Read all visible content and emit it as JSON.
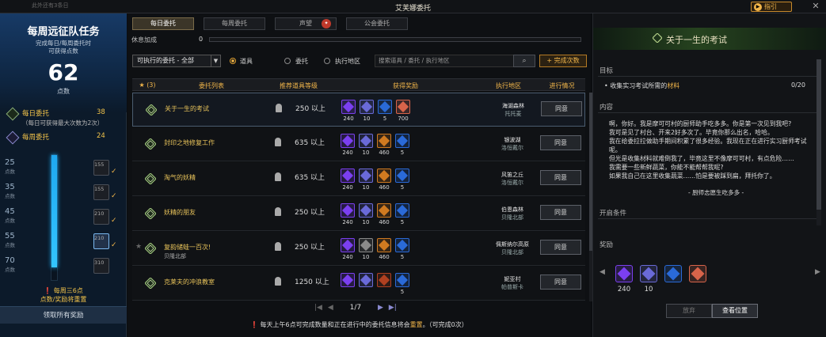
{
  "topbar": {
    "title": "艾芙娜委托",
    "tiny": "此外还有3条日",
    "guide": "指引",
    "close": "✕"
  },
  "left": {
    "title": "每周远征队任务",
    "subtitle_1": "完成每日/每周委托时",
    "subtitle_2": "可获得点数",
    "points": "62",
    "points_unit": "点数",
    "daily_label": "每日委托",
    "daily_value": "38",
    "daily_note": "（每日可获得最大次数为2次）",
    "weekly_label": "每周委托",
    "weekly_value": "24",
    "progress": 0.9,
    "steps": [
      {
        "pts": "25",
        "unit": "点数",
        "badge": "155"
      },
      {
        "pts": "35",
        "unit": "点数",
        "badge": "155"
      },
      {
        "pts": "45",
        "unit": "点数",
        "badge": "210"
      },
      {
        "pts": "55",
        "unit": "点数",
        "badge": "210"
      },
      {
        "pts": "70",
        "unit": "点数",
        "badge": "310"
      }
    ],
    "note_1": "每周三6点",
    "note_2": "点数/奖励将重置",
    "claim_button": "领取所有奖励"
  },
  "tabs": [
    "每日委托",
    "每周委托",
    "声望",
    "公会委托"
  ],
  "tabs_active": 0,
  "rest": {
    "label": "休息加成",
    "value": "0"
  },
  "filter": {
    "select": "可执行的委托 - 全部",
    "radio_options": [
      "道具",
      "委托",
      "执行地区"
    ],
    "radio_selected": 0,
    "search_placeholder": "搜索道具 / 委托 / 执行地区",
    "complete_count": "+ 完成次数"
  },
  "table": {
    "headers": [
      "(3)",
      "委托列表",
      "推荐道具等级",
      "获得奖励",
      "执行地区",
      "进行情况"
    ],
    "rows": [
      {
        "name": "关于一生的考试",
        "sub": "",
        "level": "250 以上",
        "rewards": [
          {
            "color": "#7b3ff0",
            "n": "240"
          },
          {
            "color": "#6a6ad8",
            "n": "10"
          },
          {
            "color": "#2a6ad8",
            "n": "5"
          },
          {
            "color": "#d8644a",
            "n": "700"
          }
        ],
        "region": "海湖森林",
        "region2": "托托麦",
        "action": "同意"
      },
      {
        "name": "封印之地修复工作",
        "sub": "",
        "level": "635 以上",
        "rewards": [
          {
            "color": "#7b3ff0",
            "n": "240"
          },
          {
            "color": "#6a6ad8",
            "n": "10"
          },
          {
            "color": "#d07a20",
            "n": "460"
          },
          {
            "color": "#2a6ad8",
            "n": "5"
          }
        ],
        "region": "银波湖",
        "region2": "洛恒戴尔",
        "action": "同意"
      },
      {
        "name": "淘气的妖精",
        "sub": "",
        "level": "635 以上",
        "rewards": [
          {
            "color": "#7b3ff0",
            "n": "240"
          },
          {
            "color": "#6a6ad8",
            "n": "10"
          },
          {
            "color": "#d07a20",
            "n": "460"
          },
          {
            "color": "#2a6ad8",
            "n": "5"
          }
        ],
        "region": "风笛之丘",
        "region2": "洛恒戴尔",
        "action": "同意"
      },
      {
        "name": "妖精的朋友",
        "sub": "",
        "level": "250 以上",
        "rewards": [
          {
            "color": "#7b3ff0",
            "n": "240"
          },
          {
            "color": "#6a6ad8",
            "n": "10"
          },
          {
            "color": "#d07a20",
            "n": "460"
          },
          {
            "color": "#2a6ad8",
            "n": "5"
          }
        ],
        "region": "伯恩森林",
        "region2": "贝隆北部",
        "action": "同意"
      },
      {
        "name": "复韵储蛙一百次!",
        "sub": "贝隆北部",
        "level": "250 以上",
        "rewards": [
          {
            "color": "#7b3ff0",
            "n": "240"
          },
          {
            "color": "#8a8a8a",
            "n": "10"
          },
          {
            "color": "#d07a20",
            "n": "460"
          },
          {
            "color": "#2a6ad8",
            "n": "5"
          }
        ],
        "region": "佩斯纳尔高原",
        "region2": "贝隆北部",
        "action": "同意"
      },
      {
        "name": "克莱夫的冲浪教室",
        "sub": "",
        "level": "1250 以上",
        "rewards": [
          {
            "color": "#7b3ff0",
            "n": ""
          },
          {
            "color": "#6a6ad8",
            "n": ""
          },
          {
            "color": "#b04020",
            "n": ""
          },
          {
            "color": "#2a6ad8",
            "n": "5"
          }
        ],
        "region": "妮亚村",
        "region2": "帕普斯卡",
        "action": "同意"
      }
    ]
  },
  "pager": {
    "text": "1/7"
  },
  "footer": {
    "pre": "每天上午6点可完成数量和正在进行中的委托信息将会",
    "hl": "重置",
    "post": "。（可完成0次）"
  },
  "detail": {
    "title": "关于一生的考试",
    "goal_label": "目标",
    "goal_text": "收集实习考试所需的",
    "goal_hl": "材料",
    "goal_count": "0/20",
    "content_label": "内容",
    "content_lines": [
      "啊，你好。我是摩可可村的厨师助手吃多多。你是第一次见到我吧?",
      "我可是见了村台、开来2好多次了。毕竟你那么出名，哈哈。",
      "我在给委拉拉做助手期间积累了很多经验。我现在正在进行实习厨师考试呢。",
      "但光是收集材料就难倒我了，毕竟这里不像摩可可村，有点危险……",
      "我需要一些新鲜蔬菜，你能不能帮帮我呢?",
      "如果我自己在这里收集蔬菜……怕是要被踩到扁，拜托你了。"
    ],
    "signature": "- 厨师志愿生吃多多 -",
    "condition_label": "开启条件",
    "reward_label": "奖励",
    "rewards": [
      {
        "color": "#7b3ff0",
        "n": "240"
      },
      {
        "color": "#6a6ad8",
        "n": "10"
      },
      {
        "color": "#2a6ad8",
        "n": "5"
      },
      {
        "color": "#d8644a",
        "n": "700"
      }
    ],
    "abandon": "放弃",
    "locate": "查看位置"
  }
}
